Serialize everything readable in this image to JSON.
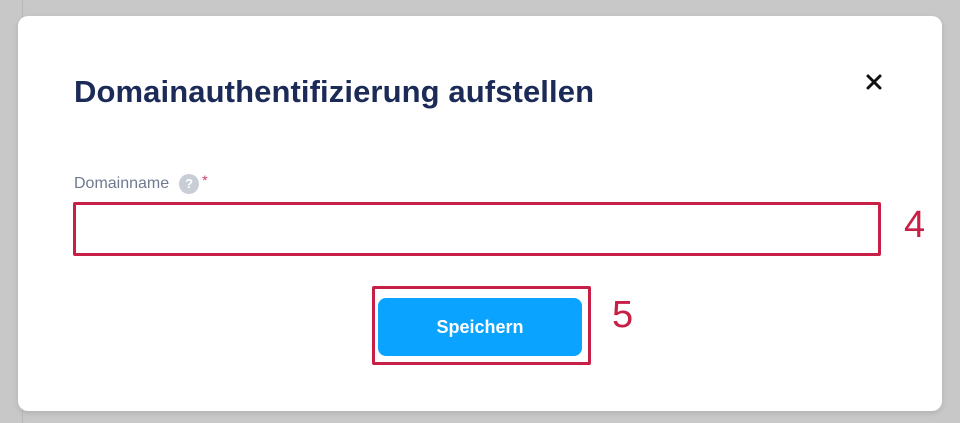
{
  "dialog": {
    "title": "Domainauthentifizierung aufstellen",
    "close_icon": "close-icon"
  },
  "form": {
    "domain_field": {
      "label": "Domainname",
      "help_icon": "question-circle-icon",
      "help_glyph": "?",
      "required_marker": "*",
      "value": "",
      "placeholder": ""
    },
    "save_label": "Speichern"
  },
  "annotations": {
    "input_marker": "4",
    "button_marker": "5"
  },
  "colors": {
    "title": "#1b2a57",
    "label": "#6f7a8e",
    "required": "#d63a6a",
    "primary_button": "#0aa3ff",
    "annotation": "#c71f45",
    "backdrop": "#c8c8c8"
  }
}
